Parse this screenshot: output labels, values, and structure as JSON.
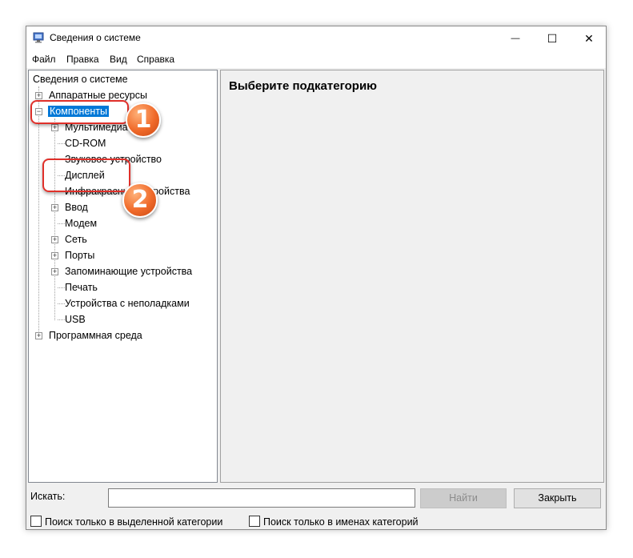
{
  "window": {
    "title": "Сведения о системе",
    "minimize_glyph": "—",
    "maximize_glyph": "☐",
    "close_glyph": "✕"
  },
  "menu": [
    "Файл",
    "Правка",
    "Вид",
    "Справка"
  ],
  "tree": {
    "root": "Сведения о системе",
    "hardware": "Аппаратные ресурсы",
    "components": "Компоненты",
    "multimedia": "Мультимедиа",
    "cdrom": "CD-ROM",
    "sound": "Звуковое устройство",
    "display": "Дисплей",
    "infrared": "Инфракрасные устройства",
    "input": "Ввод",
    "modem": "Модем",
    "network": "Сеть",
    "ports": "Порты",
    "storage": "Запоминающие устройства",
    "printing": "Печать",
    "problem_devices": "Устройства с неполадками",
    "usb": "USB",
    "software": "Программная среда"
  },
  "content": {
    "title": "Выберите подкатегорию"
  },
  "search": {
    "label": "Искать:",
    "value": "",
    "find_button": "Найти",
    "close_button": "Закрыть",
    "option_selected_category": "Поиск только в выделенной категории",
    "option_category_names": "Поиск только в именах категорий"
  },
  "annotations": {
    "badge1": "1",
    "badge2": "2"
  },
  "colors": {
    "selection": "#0078d7",
    "callout": "#e0302a",
    "badge": "#f06a2a"
  }
}
